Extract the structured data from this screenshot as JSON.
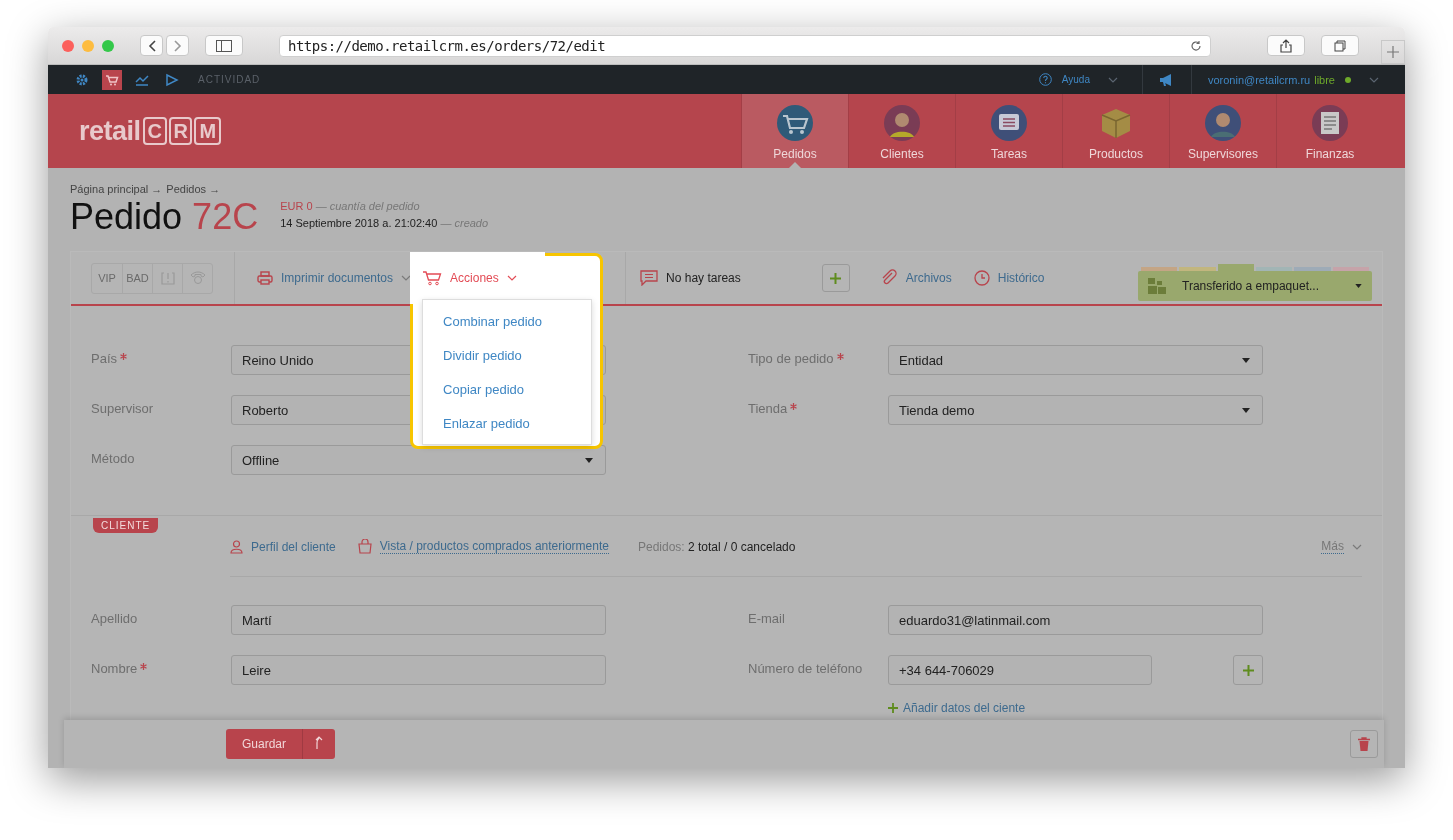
{
  "browser": {
    "url": "https://demo.retailcrm.es/orders/72/edit"
  },
  "topbar": {
    "icons": [
      {
        "kind": "settings",
        "selected": false
      },
      {
        "kind": "cart",
        "selected": true
      },
      {
        "kind": "chart",
        "selected": false
      },
      {
        "kind": "play",
        "selected": false
      }
    ],
    "activity": "ACTIVIDAD",
    "help": "Ayuda",
    "user": "voronin@retailcrm.ru",
    "plan": "libre"
  },
  "header": {
    "logo_word": "retail",
    "logo_letters": [
      "C",
      "R",
      "M"
    ],
    "nav": [
      {
        "label": "Pedidos",
        "kind": "cart",
        "selected": true
      },
      {
        "label": "Clientes",
        "kind": "person",
        "selected": false
      },
      {
        "label": "Tareas",
        "kind": "list",
        "selected": false
      },
      {
        "label": "Productos",
        "kind": "box",
        "selected": false
      },
      {
        "label": "Supervisores",
        "kind": "person2",
        "selected": false
      },
      {
        "label": "Finanzas",
        "kind": "ledger",
        "selected": false
      }
    ]
  },
  "page": {
    "breadcrumb": [
      "Página principal →",
      "Pedidos →"
    ],
    "title": "Pedido",
    "number": "72C",
    "amount": "EUR 0",
    "amount_note": "— cuantía del pedido",
    "date": "14 Septiembre 2018 a. 21:02:40",
    "date_note": "— creado"
  },
  "toolbar": {
    "tags": [
      "VIP",
      "BAD"
    ],
    "print": "Imprimir documentos",
    "actions": {
      "label": "Acciones",
      "expanded": true,
      "items": [
        "Combinar pedido",
        "Dividir pedido",
        "Copiar pedido",
        "Enlazar pedido"
      ]
    },
    "tasks": "No hay tareas",
    "files": "Archivos",
    "history": "Histórico",
    "status": {
      "label": "Transferido a empaquet...",
      "steps": [
        {
          "color": "#c4a585",
          "selected": false
        },
        {
          "color": "#c2b67e",
          "selected": false
        },
        {
          "color": "#99a86d",
          "selected": true
        },
        {
          "color": "#a2b5b5",
          "selected": false
        },
        {
          "color": "#9eabb7",
          "selected": false
        },
        {
          "color": "#c6a3a9",
          "selected": false
        }
      ]
    }
  },
  "order_fields": {
    "left": [
      {
        "label": "País",
        "required": true,
        "kind": "select",
        "value": "Reino Unido"
      },
      {
        "label": "Supervisor",
        "required": false,
        "kind": "select",
        "value": "Roberto"
      },
      {
        "label": "Método",
        "required": false,
        "kind": "select",
        "value": "Offline"
      }
    ],
    "right": [
      {
        "label": "Tipo de pedido",
        "required": true,
        "kind": "select",
        "value": "Entidad"
      },
      {
        "label": "Tienda",
        "required": true,
        "kind": "select",
        "value": "Tienda demo"
      }
    ]
  },
  "client": {
    "badge": "CLIENTE",
    "profile": "Perfil del cliente",
    "history": "Vista / productos comprados anteriormente",
    "orders_label": "Pedidos:",
    "orders": "2 total / 0 cancelado",
    "more": "Más",
    "left": [
      {
        "label": "Apellido",
        "required": false,
        "kind": "text",
        "value": "Martí"
      },
      {
        "label": "Nombre",
        "required": true,
        "kind": "text",
        "value": "Leire"
      }
    ],
    "right": [
      {
        "label": "E-mail",
        "required": false,
        "kind": "text",
        "value": "eduardo31@latinmail.com"
      },
      {
        "label": "Número de teléfono",
        "required": false,
        "kind": "phone",
        "value": "+34 644-706029"
      }
    ],
    "add_data": "Añadir datos del ciente"
  },
  "footer": {
    "save": "Guardar"
  }
}
